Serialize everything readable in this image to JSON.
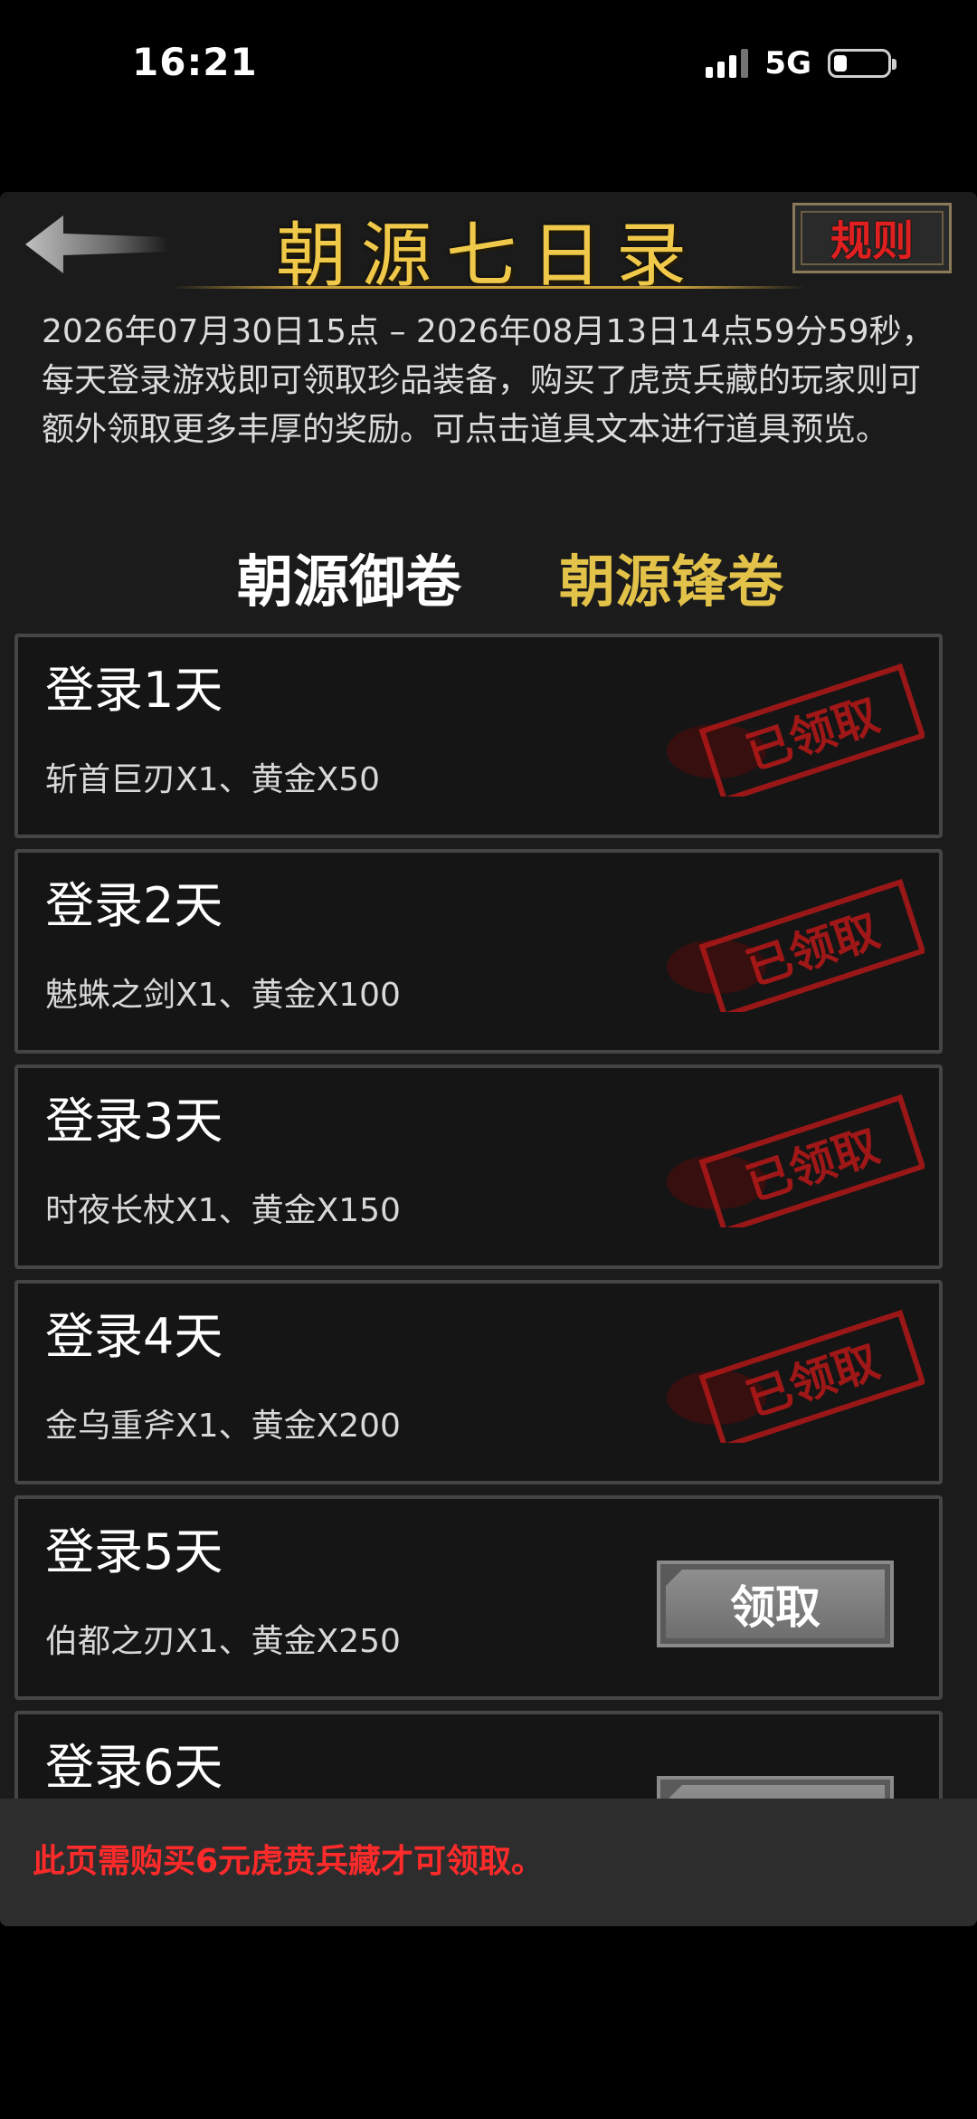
{
  "status_bar": {
    "time": "16:21",
    "network": "5G"
  },
  "header": {
    "title": "朝源七日录",
    "rules_label": "规则"
  },
  "description": "2026年07月30日15点 – 2026年08月13日14点59分59秒，每天登录游戏即可领取珍品装备，购买了虎贲兵藏的玩家则可额外领取更多丰厚的奖励。可点击道具文本进行道具预览。",
  "tabs": [
    {
      "label": "朝源御卷"
    },
    {
      "label": "朝源锋卷"
    }
  ],
  "claimed_stamp_text": "已领取",
  "claim_label": "领取",
  "days": [
    {
      "title": "登录1天",
      "reward": "斩首巨刃X1、黄金X50",
      "claimed": true
    },
    {
      "title": "登录2天",
      "reward": "魅蛛之剑X1、黄金X100",
      "claimed": true
    },
    {
      "title": "登录3天",
      "reward": "时夜长杖X1、黄金X150",
      "claimed": true
    },
    {
      "title": "登录4天",
      "reward": "金乌重斧X1、黄金X200",
      "claimed": true
    },
    {
      "title": "登录5天",
      "reward": "伯都之刃X1、黄金X250",
      "claimed": false
    },
    {
      "title": "登录6天",
      "reward": "",
      "claimed": false
    }
  ],
  "footer_note": "此页需购买6元虎贲兵藏才可领取。",
  "colors": {
    "title_gold": "#f0c94a",
    "stamp_red": "#b01818",
    "note_red": "#ff2a2a"
  }
}
